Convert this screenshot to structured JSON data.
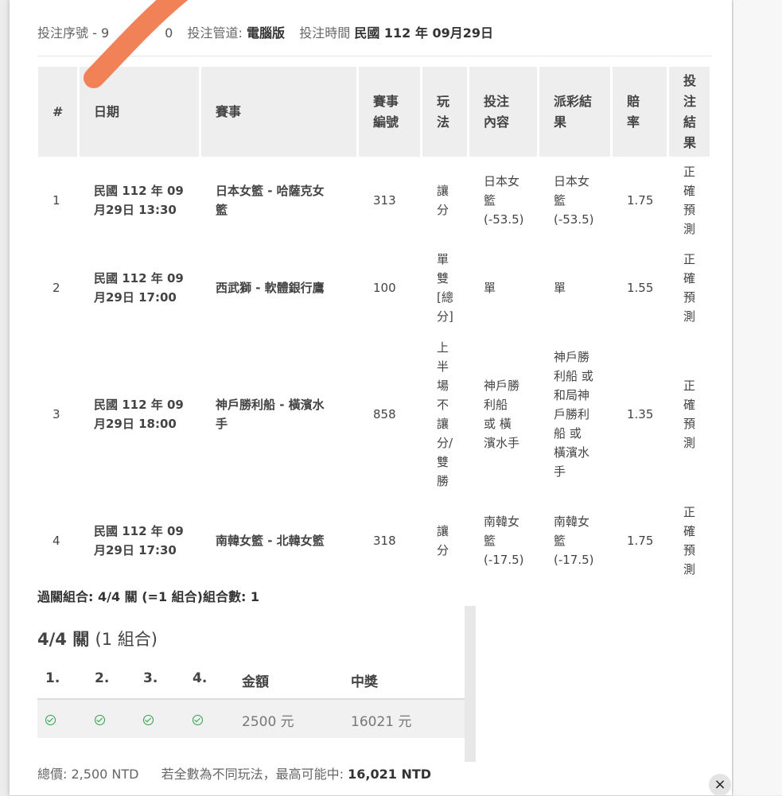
{
  "header": {
    "serial_label": "投注序號",
    "serial_value": "- 9",
    "serial_tail": "0",
    "channel_label": "投注管道:",
    "channel_value": "電腦版",
    "time_label": "投注時間",
    "time_value": "民國 112 年 09月29日"
  },
  "table": {
    "headers": [
      "#",
      "日期",
      "賽事",
      "賽事\n編號",
      "玩\n法",
      "投注\n內容",
      "派彩結\n果",
      "賠\n率",
      "投\n注\n結\n果"
    ],
    "rows": [
      {
        "num": "1",
        "date": "民國 112 年 09\n月29日 13:30",
        "event": "日本女籃 - 哈薩克女\n籃",
        "event_no": "313",
        "play": "讓\n分",
        "bet": "日本女\n籃\n(-53.5)",
        "payout": "日本女\n籃\n(-53.5)",
        "odds": "1.75",
        "result": "正\n確\n預\n測"
      },
      {
        "num": "2",
        "date": "民國 112 年 09\n月29日 17:00",
        "event": "西武獅 - 軟體銀行鷹",
        "event_no": "100",
        "play": "單\n雙\n[總\n分]",
        "bet": "單",
        "payout": "單",
        "odds": "1.55",
        "result": "正\n確\n預\n測"
      },
      {
        "num": "3",
        "date": "民國 112 年 09\n月29日 18:00",
        "event": "神戶勝利船 - 橫濱水\n手",
        "event_no": "858",
        "play": "上\n半\n場\n不\n讓\n分/\n雙\n勝",
        "bet": "神戶勝\n利船\n或 橫\n濱水手",
        "payout": "神戶勝\n利船 或\n和局神\n戶勝利\n船 或\n橫濱水\n手",
        "odds": "1.35",
        "result": "正\n確\n預\n測"
      },
      {
        "num": "4",
        "date": "民國 112 年 09\n月29日 17:30",
        "event": "南韓女籃 - 北韓女籃",
        "event_no": "318",
        "play": "讓\n分",
        "bet": "南韓女\n籃\n(-17.5)",
        "payout": "南韓女\n籃\n(-17.5)",
        "odds": "1.75",
        "result": "正\n確\n預\n測"
      }
    ]
  },
  "summary": "過關組合: 4/4 關 (=1 組合)組合數: 1",
  "combo": {
    "title": "4/4 關",
    "title_suffix": "(1 組合)",
    "headers": [
      "1.",
      "2.",
      "3.",
      "4.",
      "金額",
      "中獎"
    ],
    "row": {
      "amount": "2500 元",
      "prize": "16021 元"
    }
  },
  "footer": {
    "total_label": "總價:",
    "total_value": "2,500 NTD",
    "max_label": "若全數為不同玩法，最高可能中:",
    "max_value": "16,021 NTD"
  },
  "close_icon": "×",
  "colors": {
    "check": "#2e9e4a",
    "brush": "#f07a4e"
  }
}
